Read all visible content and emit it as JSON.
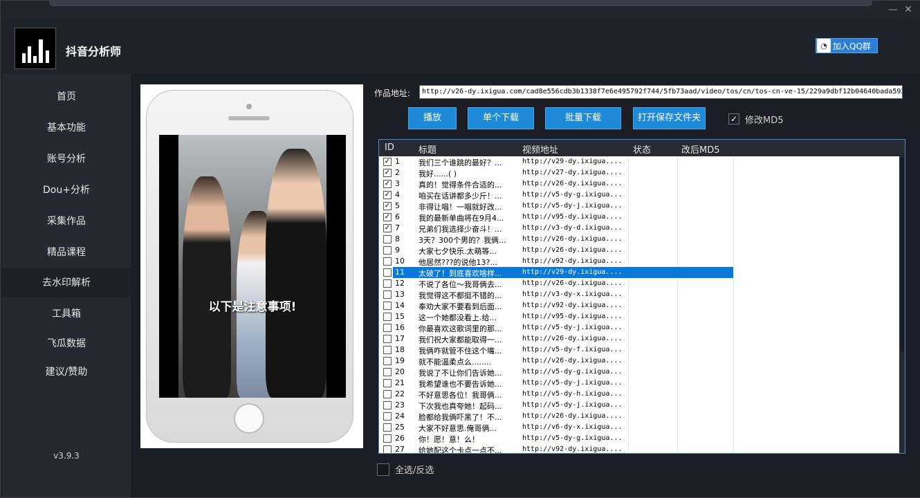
{
  "app": {
    "title": "抖音分析师",
    "version": "v3.9.3",
    "qq_button": "加入QQ群"
  },
  "window_controls": {
    "minimize": "—",
    "close": "✕"
  },
  "sidebar": {
    "items": [
      {
        "label": "首页"
      },
      {
        "label": "基本功能"
      },
      {
        "label": "账号分析"
      },
      {
        "label": "Dou+分析"
      },
      {
        "label": "采集作品"
      },
      {
        "label": "精品课程"
      },
      {
        "label": "去水印解析",
        "active": true
      },
      {
        "label": "工具箱"
      },
      {
        "label": "飞瓜数据"
      },
      {
        "label": "建议/赞助"
      }
    ]
  },
  "preview": {
    "overlay_text": "以下是注意事项!"
  },
  "url_bar": {
    "label": "作品地址:",
    "value": "http://v26-dy.ixigua.com/cad8e556cdb3b1338f7e6e495792f744/5fb73aad/video/tos/cn/tos-cn-ve-15/229a9dbf12b04640bada592"
  },
  "buttons": {
    "play": "播放",
    "single_download": "单个下载",
    "batch_download": "批量下载",
    "open_folder": "打开保存文件夹"
  },
  "modify_md5": {
    "label": "修改MD5",
    "checked": true,
    "mark": "✓"
  },
  "table": {
    "columns": {
      "id": "ID",
      "title": "标题",
      "url": "视频地址",
      "status": "状态",
      "md5": "改后MD5"
    },
    "check_mark": "✓",
    "rows": [
      {
        "id": "1",
        "title": "我们三个谁跳的最好？...",
        "url": "http://v29-dy.ixigua....",
        "checked": true
      },
      {
        "id": "2",
        "title": "我好......(     )",
        "url": "http://v27-dy.ixigua....",
        "checked": true
      },
      {
        "id": "3",
        "title": "真的！觉得条件合适的...",
        "url": "http://v26-dy.ixigua....",
        "checked": true
      },
      {
        "id": "4",
        "title": "咱买在话讲都多少斤！...",
        "url": "http://v5-dy-g.ixigua...",
        "checked": true
      },
      {
        "id": "5",
        "title": "非得让唱！一唱就好改...",
        "url": "http://v5-dy-j.ixigua...",
        "checked": true
      },
      {
        "id": "6",
        "title": "我的最新单曲将在9月4...",
        "url": "http://v95-dy.ixigua....",
        "checked": true
      },
      {
        "id": "7",
        "title": "兄弟们我选择少奋斗！...",
        "url": "http://v3-dy-d.ixigua...",
        "checked": true
      },
      {
        "id": "8",
        "title": "3天？300个男的？我俩...",
        "url": "http://v26-dy.ixigua....",
        "checked": false
      },
      {
        "id": "9",
        "title": "大家七夕快乐.太萌等...",
        "url": "http://v26-dy.ixigua....",
        "checked": false
      },
      {
        "id": "10",
        "title": "他居然???的说他13?...",
        "url": "http://v92-dy.ixigua....",
        "checked": false
      },
      {
        "id": "11",
        "title": "太破了！到底喜欢啥样...",
        "url": "http://v29-dy.ixigua....",
        "checked": false,
        "selected": true
      },
      {
        "id": "12",
        "title": "不说了各位～我哥俩去...",
        "url": "http://v26-dy.ixigua....",
        "checked": false
      },
      {
        "id": "13",
        "title": "我觉得这不都挺不错的...",
        "url": "http://v3-dy-x.ixigua...",
        "checked": false
      },
      {
        "id": "14",
        "title": "奉劝大家不要看到后面...",
        "url": "http://v92-dy.ixigua....",
        "checked": false
      },
      {
        "id": "15",
        "title": "这一个她都没看上.给...",
        "url": "http://v95-dy.ixigua....",
        "checked": false
      },
      {
        "id": "16",
        "title": "你最喜欢这歌词里的那...",
        "url": "http://v5-dy-j.ixigua...",
        "checked": false
      },
      {
        "id": "17",
        "title": "我们祝大家都能取得一...",
        "url": "http://v26-dy.ixigua....",
        "checked": false
      },
      {
        "id": "18",
        "title": "我俩咋就管不住这个嘴...",
        "url": "http://v5-dy-f.ixigua...",
        "checked": false
      },
      {
        "id": "19",
        "title": "就不能温柔点么........",
        "url": "http://v26-dy.ixigua....",
        "checked": false
      },
      {
        "id": "20",
        "title": "我说了不让你们告诉她...",
        "url": "http://v5-dy-g.ixigua...",
        "checked": false
      },
      {
        "id": "21",
        "title": "我希望谁也不要告诉她...",
        "url": "http://v5-dy-j.ixigua...",
        "checked": false
      },
      {
        "id": "22",
        "title": "不好意思各位！我哥俩...",
        "url": "http://v5-dy-h.ixigua...",
        "checked": false
      },
      {
        "id": "23",
        "title": "下次我也真夸她！起码...",
        "url": "http://v5-dy-j.ixigua...",
        "checked": false
      },
      {
        "id": "24",
        "title": "脸都给我俩吓黑了！不...",
        "url": "http://v26-dy.ixigua....",
        "checked": false
      },
      {
        "id": "25",
        "title": "大家不好意思.俺哥俩...",
        "url": "http://v6-dy-x.ixigua...",
        "checked": false
      },
      {
        "id": "26",
        "title": "你！愿！意！么！",
        "url": "http://v5-dy-g.ixigua...",
        "checked": false
      },
      {
        "id": "27",
        "title": "给她配这个卡点一点不...",
        "url": "http://v92-dy.ixigua....",
        "checked": false
      }
    ]
  },
  "select_all": {
    "label": "全选/反选"
  },
  "colors": {
    "accent": "#1f8ad8",
    "selection": "#0a78d7",
    "sidebar_bg": "#252a32",
    "window_bg": "#1e232a"
  }
}
